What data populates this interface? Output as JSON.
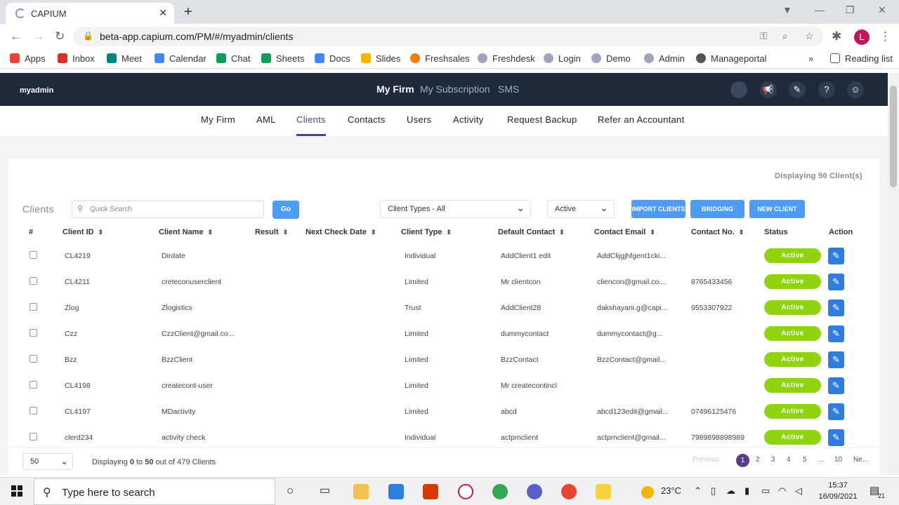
{
  "browser": {
    "tab_title": "CAPIUM",
    "url": "beta-app.capium.com/PM/#/myadmin/clients",
    "profile_initial": "L",
    "bookmarks": [
      {
        "label": "Apps",
        "color": "#ea4335"
      },
      {
        "label": "Inbox",
        "color": "#d93025"
      },
      {
        "label": "Meet",
        "color": "#00897b"
      },
      {
        "label": "Calendar",
        "color": "#4285f4"
      },
      {
        "label": "Chat",
        "color": "#0f9d58"
      },
      {
        "label": "Sheets",
        "color": "#0f9d58"
      },
      {
        "label": "Docs",
        "color": "#4285f4"
      },
      {
        "label": "Slides",
        "color": "#f4b400"
      },
      {
        "label": "Freshsales",
        "color": "#f57c00"
      },
      {
        "label": "Freshdesk",
        "color": "#9aa7bd"
      },
      {
        "label": "Login",
        "color": "#9aa7bd"
      },
      {
        "label": "Demo",
        "color": "#9aa7bd"
      },
      {
        "label": "Admin",
        "color": "#9aa7bd"
      },
      {
        "label": "Manageportal",
        "color": "#555555"
      }
    ],
    "reading_list": "Reading list",
    "more": "»"
  },
  "header": {
    "app_name": "myadmin",
    "nav": [
      "My Firm",
      "My Subscription",
      "SMS"
    ]
  },
  "subnav": [
    "My Firm",
    "AML",
    "Clients",
    "Contacts",
    "Users",
    "Activity",
    "Request Backup",
    "Refer an Accountant"
  ],
  "toolbar": {
    "displaying_top": "Displaying 50 Client(s)",
    "section_label": "Clients",
    "search_placeholder": "Quick Search",
    "go": "Go",
    "client_type": "Client Types - All",
    "status_filter": "Active",
    "import": "IMPORT CLIENTS",
    "bridging": "BRIDGING",
    "new_client": "NEW CLIENT"
  },
  "table": {
    "headers": [
      "#",
      "Client ID",
      "Client Name",
      "Result",
      "Next Check Date",
      "Client Type",
      "Default Contact",
      "Contact Email",
      "Contact No.",
      "Status",
      "Action"
    ],
    "rows": [
      {
        "id": "CL4219",
        "name": "Dirdate",
        "type": "Individual",
        "contact": "AddClient1 edit",
        "email": "AddClijgjhfgent1cki...",
        "phone": "",
        "status": "Active"
      },
      {
        "id": "CL4211",
        "name": "creteconuserclient",
        "type": "Limited",
        "contact": "Mr clientcon",
        "email": "cliencon@gmail.co...",
        "phone": "8765433456",
        "status": "Active"
      },
      {
        "id": "Zlog",
        "name": "Zlogistics",
        "type": "Trust",
        "contact": "AddClient28",
        "email": "dakshayani.g@capi...",
        "phone": "9553307922",
        "status": "Active"
      },
      {
        "id": "Czz",
        "name": "CzzClient@gmail.co...",
        "type": "Limited",
        "contact": "dummycontact",
        "email": "dummycontact@g...",
        "phone": "",
        "status": "Active"
      },
      {
        "id": "Bzz",
        "name": "BzzClient",
        "type": "Limited",
        "contact": "BzzContact",
        "email": "BzzContact@gmail...",
        "phone": "",
        "status": "Active"
      },
      {
        "id": "CL4198",
        "name": "createcont-user",
        "type": "Limited",
        "contact": "Mr createcontincl",
        "email": "",
        "phone": "",
        "status": "Active"
      },
      {
        "id": "CL4197",
        "name": "MDactivity",
        "type": "Limited",
        "contact": "abcd",
        "email": "abcd123edit@gmail...",
        "phone": "07496125476",
        "status": "Active"
      },
      {
        "id": "clerd234",
        "name": "activity check",
        "type": "Individual",
        "contact": "actpmclient",
        "email": "actpmclient@gmail...",
        "phone": "7989898898989",
        "status": "Active"
      }
    ]
  },
  "footer": {
    "page_size": "50",
    "displaying_prefix": "Displaying ",
    "from": "0",
    "to_word": " to ",
    "to": "50",
    "out_of": " out of 479 Clients",
    "previous": "Previous",
    "pages": [
      "1",
      "2",
      "3",
      "4",
      "5",
      "...",
      "10"
    ],
    "next": "Ne..."
  },
  "taskbar": {
    "search_placeholder": "Type here to search",
    "weather": "23°C",
    "time": "15:37",
    "date": "16/09/2021",
    "notifications": "21"
  }
}
